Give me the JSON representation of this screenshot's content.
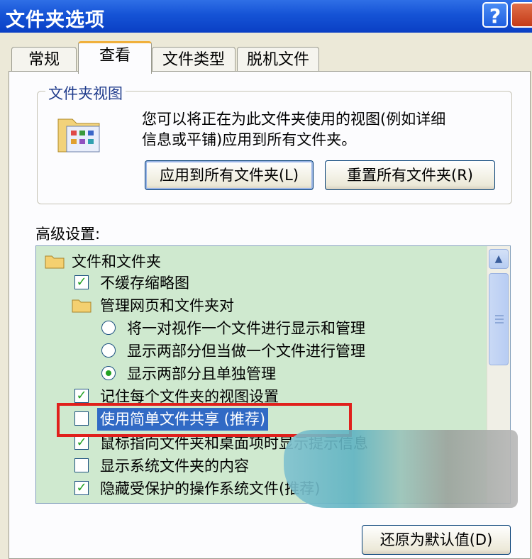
{
  "window": {
    "title": "文件夹选项",
    "help_glyph": "?"
  },
  "tabs": [
    {
      "label": "常规"
    },
    {
      "label": "查看"
    },
    {
      "label": "文件类型"
    },
    {
      "label": "脱机文件"
    }
  ],
  "folder_view": {
    "group_title": "文件夹视图",
    "description_line1": "您可以将正在为此文件夹使用的视图(例如详细",
    "description_line2": "信息或平铺)应用到所有文件夹。",
    "apply_button": "应用到所有文件夹(L)",
    "reset_button": "重置所有文件夹(R)"
  },
  "advanced": {
    "label": "高级设置:",
    "items": [
      {
        "type": "folder",
        "text": "文件和文件夹"
      },
      {
        "type": "checkbox",
        "checked": true,
        "text": "不缓存缩略图"
      },
      {
        "type": "folder",
        "text": "管理网页和文件夹对"
      },
      {
        "type": "radio",
        "checked": false,
        "text": "将一对视作一个文件进行显示和管理"
      },
      {
        "type": "radio",
        "checked": false,
        "text": "显示两部分但当做一个文件进行管理"
      },
      {
        "type": "radio",
        "checked": true,
        "text": "显示两部分且单独管理"
      },
      {
        "type": "checkbox",
        "checked": true,
        "text": "记住每个文件夹的视图设置"
      },
      {
        "type": "checkbox",
        "checked": false,
        "text": "使用简单文件共享 (推荐)"
      },
      {
        "type": "checkbox",
        "checked": true,
        "text": "鼠标指向文件夹和桌面项时显示提示信息"
      },
      {
        "type": "checkbox",
        "checked": false,
        "text": "显示系统文件夹的内容"
      },
      {
        "type": "checkbox",
        "checked": true,
        "text": "隐藏受保护的操作系统文件(推荐)"
      }
    ]
  },
  "restore_button": "还原为默认值(D)",
  "colors": {
    "highlight": "#e0201c",
    "selection": "#316ac5",
    "list_bg": "#cfe9cf"
  }
}
